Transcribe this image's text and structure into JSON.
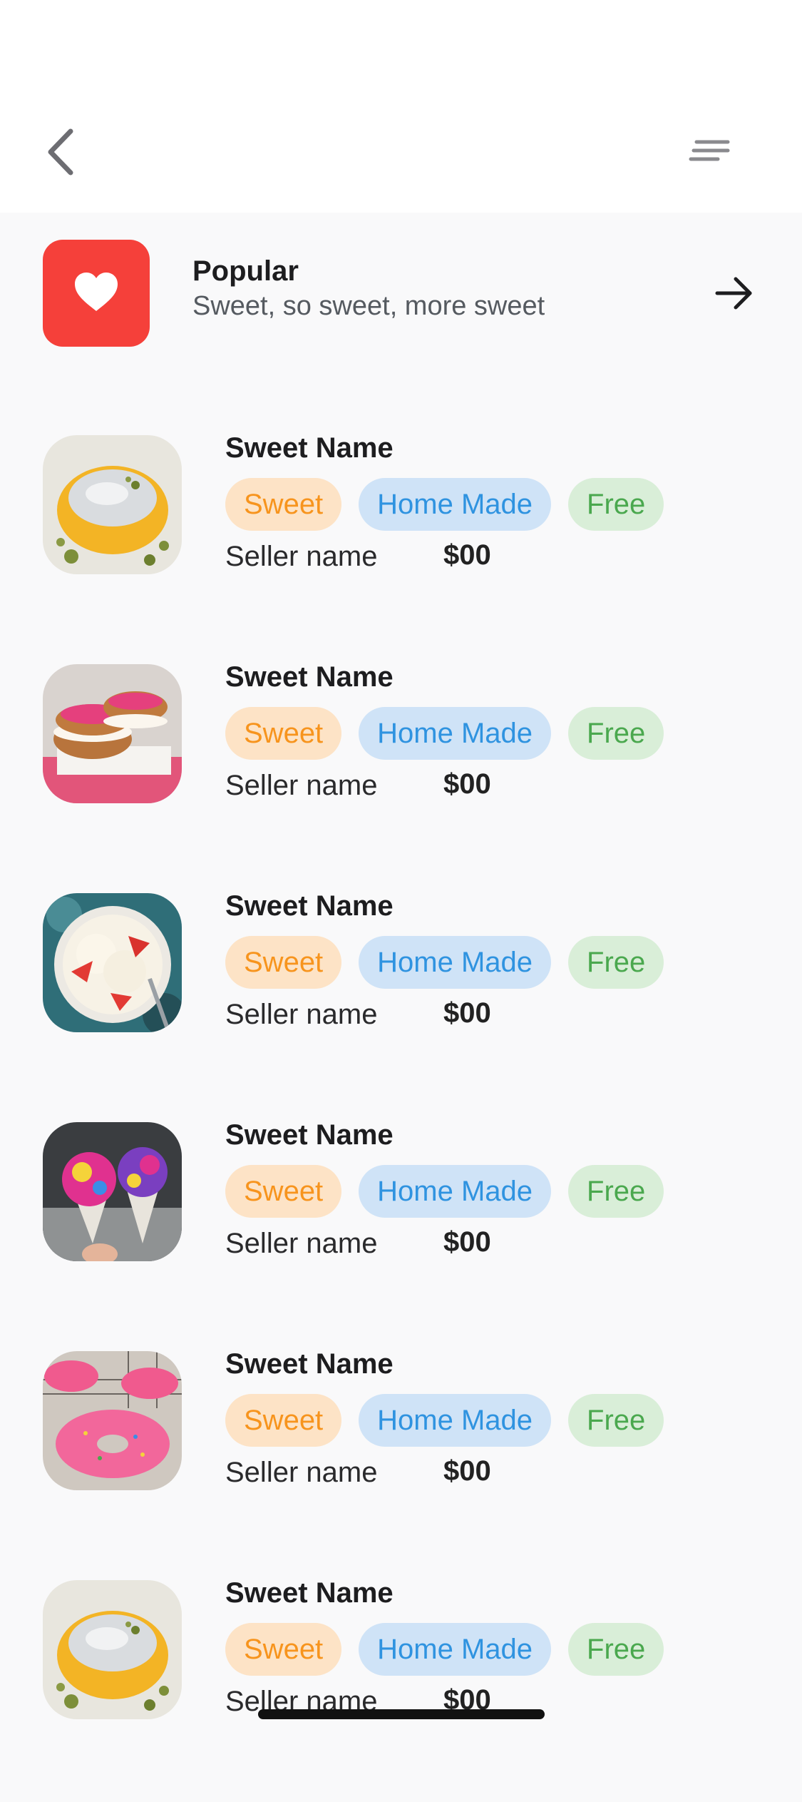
{
  "header": {
    "back_icon": "chevron-left-icon",
    "menu_icon": "menu-lines-icon"
  },
  "category": {
    "icon": "heart-icon",
    "icon_bg": "#f5403a",
    "title": "Popular",
    "subtitle": "Sweet, so sweet, more sweet",
    "arrow_icon": "arrow-right-icon"
  },
  "items": [
    {
      "name": "Sweet Name",
      "tags": [
        "Sweet",
        "Home Made",
        "Free"
      ],
      "seller": "Seller name",
      "price": "$00",
      "image": "sweet-pastry-photo"
    },
    {
      "name": "Sweet Name",
      "tags": [
        "Sweet",
        "Home Made",
        "Free"
      ],
      "seller": "Seller name",
      "price": "$00",
      "image": "donut-sandwich-photo"
    },
    {
      "name": "Sweet Name",
      "tags": [
        "Sweet",
        "Home Made",
        "Free"
      ],
      "seller": "Seller name",
      "price": "$00",
      "image": "ice-cream-bowl-photo"
    },
    {
      "name": "Sweet Name",
      "tags": [
        "Sweet",
        "Home Made",
        "Free"
      ],
      "seller": "Seller name",
      "price": "$00",
      "image": "ice-cream-cones-photo"
    },
    {
      "name": "Sweet Name",
      "tags": [
        "Sweet",
        "Home Made",
        "Free"
      ],
      "seller": "Seller name",
      "price": "$00",
      "image": "pink-donuts-photo"
    },
    {
      "name": "Sweet Name",
      "tags": [
        "Sweet",
        "Home Made",
        "Free"
      ],
      "seller": "Seller name",
      "price": "$00",
      "image": "sweet-pastry-photo"
    }
  ],
  "colors": {
    "tag_sweet_bg": "#fde3c6",
    "tag_sweet_text": "#f7941d",
    "tag_home_bg": "#cfe3f7",
    "tag_home_text": "#2f93e0",
    "tag_free_bg": "#d9eed8",
    "tag_free_text": "#4aa84e"
  }
}
